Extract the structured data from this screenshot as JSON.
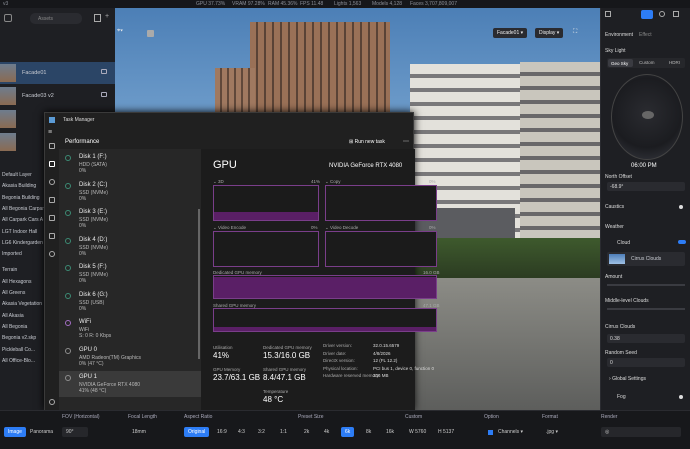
{
  "app": {
    "title": "v3"
  },
  "top_stats": {
    "gpu": "GPU 37.73%",
    "vram": "VRAM 97.28%",
    "ram": "RAM 45.36%",
    "fps": "FPS 11.48",
    "lights": "Lights 1,563",
    "models": "Models 4,128",
    "faces": "Faces 3,707,809,007"
  },
  "scenes": {
    "search_placeholder": "Assets",
    "items": [
      {
        "label": "Facade01"
      },
      {
        "label": "Facade03 v2"
      },
      {
        "label": ""
      },
      {
        "label": ""
      }
    ]
  },
  "layers": [
    "Default Layer",
    "Akasia Building",
    "Begonia Building",
    "All Begonia Carpark",
    "All Carpark Cars A",
    "LGT Indoor Hall",
    "LG6 Kindergarden",
    "Imported",
    "Terrain",
    "All Hexagons",
    "All Greens",
    "Akasia Vegetation",
    "All Akasia",
    "All Begonia",
    "Begonia v2.skp",
    "Pickleball Co...",
    "All Office-Blo..."
  ],
  "viewport": {
    "camera": "Facade01",
    "display": "Display"
  },
  "task_manager": {
    "title": "Task Manager",
    "section": "Performance",
    "run_task": "Run new task",
    "devices": [
      {
        "name": "Disk 1 (F:)",
        "sub": "HDD (SATA)",
        "val": "0%"
      },
      {
        "name": "Disk 2 (C:)",
        "sub": "SSD (NVMe)",
        "val": "0%"
      },
      {
        "name": "Disk 3 (E:)",
        "sub": "SSD (NVMe)",
        "val": "0%"
      },
      {
        "name": "Disk 4 (D:)",
        "sub": "SSD (NVMe)",
        "val": "0%"
      },
      {
        "name": "Disk 5 (F:)",
        "sub": "SSD (NVMe)",
        "val": "0%"
      },
      {
        "name": "Disk 6 (G:)",
        "sub": "SSD (USB)",
        "val": "0%"
      },
      {
        "name": "WiFi",
        "sub": "WiFi",
        "val": "S: 0 R: 0 Kbps"
      },
      {
        "name": "GPU 0",
        "sub": "AMD Radeon(TM) Graphics",
        "val": "0% (47 °C)"
      },
      {
        "name": "GPU 1",
        "sub": "NVIDIA GeForce RTX 4080",
        "val": "41% (48 °C)"
      }
    ],
    "gpu_heading": "GPU",
    "gpu_model": "NVIDIA GeForce RTX 4080",
    "graphs": {
      "g3d": "3D",
      "g3d_pct": "41%",
      "copy": "Copy",
      "copy_pct": "0%",
      "venc": "Video Encode",
      "venc_pct": "0%",
      "vdec": "Video Decode",
      "vdec_pct": "0%",
      "ded": "Dedicated GPU memory",
      "ded_max": "16.0 GB",
      "shared": "Shared GPU memory",
      "shared_max": "47.1 GB"
    },
    "values": {
      "util_pct": 41,
      "dedicated_frac": 0.956,
      "shared_frac": 0.179
    },
    "stats": {
      "util_k": "Utilisation",
      "util_v": "41%",
      "ded_k": "Dedicated GPU memory",
      "ded_v": "15.3/16.0 GB",
      "gmem_k": "GPU Memory",
      "gmem_v": "23.7/63.1 GB",
      "sh_k": "Shared GPU memory",
      "sh_v": "8.4/47.1 GB",
      "temp_k": "Temperature",
      "temp_v": "48 °C"
    },
    "details": [
      {
        "k": "Driver version:",
        "v": "32.0.15.6579"
      },
      {
        "k": "Driver date:",
        "v": "4/8/2026"
      },
      {
        "k": "DirectX version:",
        "v": "12 (FL 12.2)"
      },
      {
        "k": "Physical location:",
        "v": "PCI bus 1, device 0, function 0"
      },
      {
        "k": "Hardware reserved memory:",
        "v": "336 MB"
      }
    ]
  },
  "right_panel": {
    "tab_env": "Environment",
    "tab_effect": "Effect",
    "sky_light": "Sky Light",
    "sky_tabs": [
      "Geo Sky",
      "Custom",
      "HDRI"
    ],
    "time": "06:00 PM",
    "north_offset": "North Offset",
    "north_value": "-68.9°",
    "caustics": "Caustics",
    "weather": "Weather",
    "cloud": "Cloud",
    "cloud_type": "Cirrus Clouds",
    "amount": "Amount",
    "middle": "Middle-level Clouds",
    "cirrus": "Cirrus Clouds",
    "cirrus_val": "0.38",
    "seed": "Random Seed",
    "seed_val": "0",
    "global": "Global Settings",
    "fog": "Fog"
  },
  "bottom": {
    "image": "Image",
    "panorama": "Panorama",
    "fov_label": "FOV (Horizontal)",
    "fov": "90°",
    "focal_label": "Focal Length",
    "focal": "18mm",
    "aspect_label": "Aspect Ratio",
    "aspects": [
      "Original",
      "16:9",
      "4:3",
      "3:2",
      "1:1"
    ],
    "preset_label": "Preset Size",
    "presets": [
      "2k",
      "4k",
      "6k",
      "8k",
      "16k"
    ],
    "custom_label": "Custom",
    "w": "5760",
    "h": "5137",
    "option_label": "Option",
    "channels": "Channels",
    "format_label": "Format",
    "format": ".jpg",
    "render_label": "Render"
  }
}
